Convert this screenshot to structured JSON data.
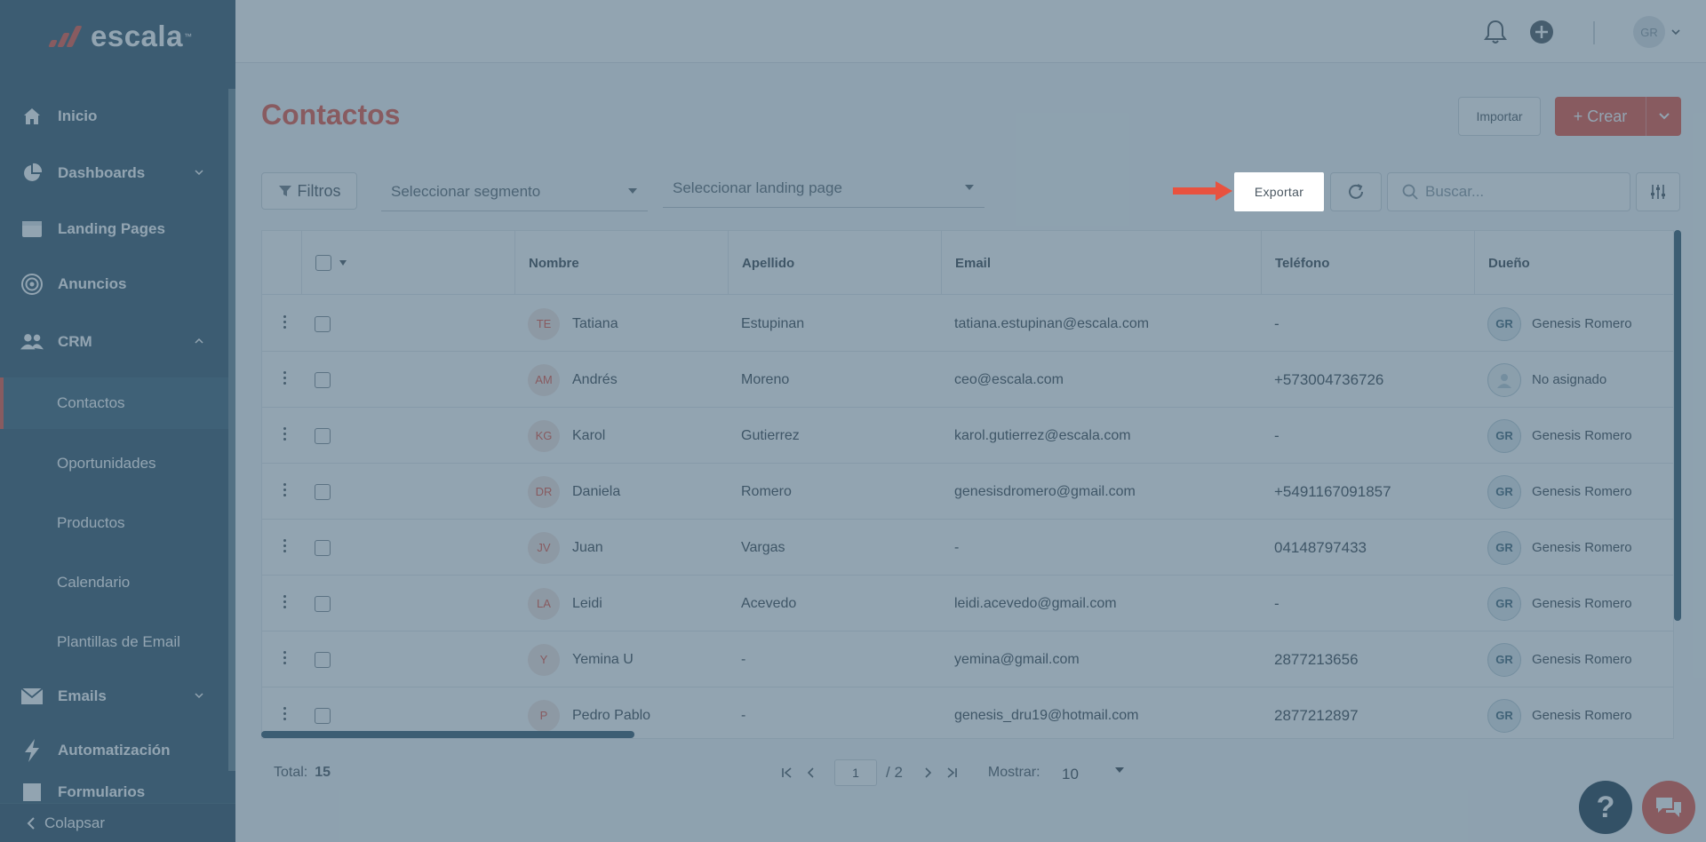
{
  "brand": {
    "name": "escala",
    "tm": "™"
  },
  "sidebar": {
    "items": [
      {
        "label": "Inicio"
      },
      {
        "label": "Dashboards"
      },
      {
        "label": "Landing Pages"
      },
      {
        "label": "Anuncios"
      },
      {
        "label": "CRM"
      },
      {
        "label": "Emails"
      },
      {
        "label": "Automatización"
      },
      {
        "label": "Formularios"
      }
    ],
    "crm_sub": [
      {
        "label": "Contactos"
      },
      {
        "label": "Oportunidades"
      },
      {
        "label": "Productos"
      },
      {
        "label": "Calendario"
      },
      {
        "label": "Plantillas de Email"
      }
    ],
    "collapse_label": "Colapsar"
  },
  "topbar": {
    "user_initials": "GR"
  },
  "page": {
    "title": "Contactos",
    "import_label": "Importar",
    "create_label": "+ Crear",
    "filter_label": "Filtros",
    "segment_placeholder": "Seleccionar segmento",
    "landing_placeholder": "Seleccionar landing page",
    "export_label": "Exportar",
    "search_placeholder": "Buscar..."
  },
  "table": {
    "columns": [
      "Nombre",
      "Apellido",
      "Email",
      "Teléfono",
      "Dueño"
    ],
    "rows": [
      {
        "initials": "TE",
        "first": "Tatiana",
        "last": "Estupinan",
        "email": "tatiana.estupinan@escala.com",
        "phone": "-",
        "owner_initials": "GR",
        "owner": "Genesis Romero"
      },
      {
        "initials": "AM",
        "first": "Andrés",
        "last": "Moreno",
        "email": "ceo@escala.com",
        "phone": "+573004736726",
        "owner_initials": "",
        "owner": "No asignado"
      },
      {
        "initials": "KG",
        "first": "Karol",
        "last": "Gutierrez",
        "email": "karol.gutierrez@escala.com",
        "phone": "-",
        "owner_initials": "GR",
        "owner": "Genesis Romero"
      },
      {
        "initials": "DR",
        "first": "Daniela",
        "last": "Romero",
        "email": "genesisdromero@gmail.com",
        "phone": "+5491167091857",
        "owner_initials": "GR",
        "owner": "Genesis Romero"
      },
      {
        "initials": "JV",
        "first": "Juan",
        "last": "Vargas",
        "email": "-",
        "phone": "04148797433",
        "owner_initials": "GR",
        "owner": "Genesis Romero"
      },
      {
        "initials": "LA",
        "first": "Leidi",
        "last": "Acevedo",
        "email": "leidi.acevedo@gmail.com",
        "phone": "-",
        "owner_initials": "GR",
        "owner": "Genesis Romero"
      },
      {
        "initials": "Y",
        "first": "Yemina U",
        "last": "-",
        "email": "yemina@gmail.com",
        "phone": "2877213656",
        "owner_initials": "GR",
        "owner": "Genesis Romero"
      },
      {
        "initials": "P",
        "first": "Pedro Pablo",
        "last": "-",
        "email": "genesis_dru19@hotmail.com",
        "phone": "2877212897",
        "owner_initials": "GR",
        "owner": "Genesis Romero"
      }
    ]
  },
  "footer": {
    "total_label": "Total:",
    "total_value": "15",
    "current_page": "1",
    "page_total": "/ 2",
    "show_label": "Mostrar:",
    "show_value": "10"
  },
  "help": {
    "label": "?"
  },
  "colors": {
    "accent": "#e8523f",
    "sidebar": "#33556a",
    "overlay": "rgba(67,99,120,0.58)"
  }
}
